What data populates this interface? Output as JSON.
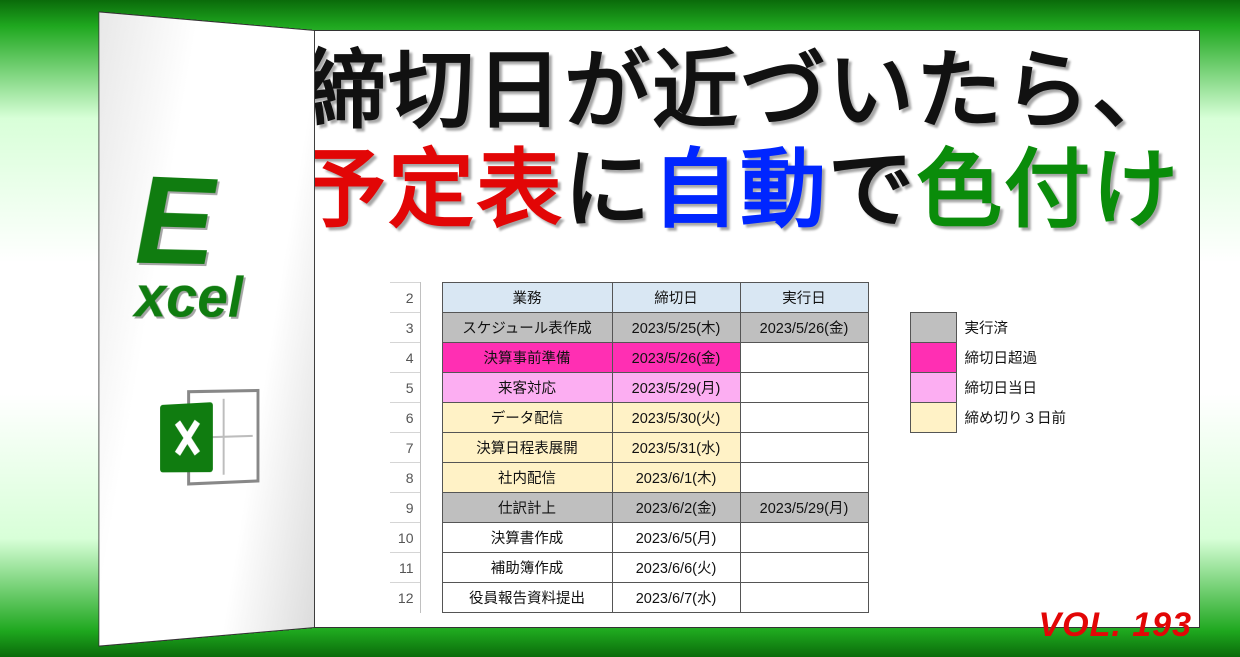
{
  "brand": {
    "big": "E",
    "rest": "xcel",
    "icon_name": "excel-icon"
  },
  "volume": "VOL. 193",
  "headline": {
    "line1": {
      "t1": "締切日が近づいたら、"
    },
    "line2": {
      "t1": "予定表",
      "t2": "に",
      "t3": "自動",
      "t4": "で",
      "t5": "色付け"
    }
  },
  "table": {
    "headers": {
      "task": "業務",
      "deadline": "締切日",
      "done": "実行日"
    },
    "rows": [
      {
        "n": 2
      },
      {
        "n": 3,
        "task": "スケジュール表作成",
        "deadline": "2023/5/25(木)",
        "done": "2023/5/26(金)",
        "cls": "done"
      },
      {
        "n": 4,
        "task": "決算事前準備",
        "deadline": "2023/5/26(金)",
        "done": "",
        "cls": "over"
      },
      {
        "n": 5,
        "task": "来客対応",
        "deadline": "2023/5/29(月)",
        "done": "",
        "cls": "today"
      },
      {
        "n": 6,
        "task": "データ配信",
        "deadline": "2023/5/30(火)",
        "done": "",
        "cls": "soon"
      },
      {
        "n": 7,
        "task": "決算日程表展開",
        "deadline": "2023/5/31(水)",
        "done": "",
        "cls": "soon"
      },
      {
        "n": 8,
        "task": "社内配信",
        "deadline": "2023/6/1(木)",
        "done": "",
        "cls": "soon"
      },
      {
        "n": 9,
        "task": "仕訳計上",
        "deadline": "2023/6/2(金)",
        "done": "2023/5/29(月)",
        "cls": "done"
      },
      {
        "n": 10,
        "task": "決算書作成",
        "deadline": "2023/6/5(月)",
        "done": "",
        "cls": "plain"
      },
      {
        "n": 11,
        "task": "補助簿作成",
        "deadline": "2023/6/6(火)",
        "done": "",
        "cls": "plain"
      },
      {
        "n": 12,
        "task": "役員報告資料提出",
        "deadline": "2023/6/7(水)",
        "done": "",
        "cls": "plain"
      }
    ],
    "legend": [
      {
        "label": "実行済",
        "cls": "done"
      },
      {
        "label": "締切日超過",
        "cls": "over"
      },
      {
        "label": "締切日当日",
        "cls": "today"
      },
      {
        "label": "締め切り３日前",
        "cls": "soon"
      }
    ]
  }
}
